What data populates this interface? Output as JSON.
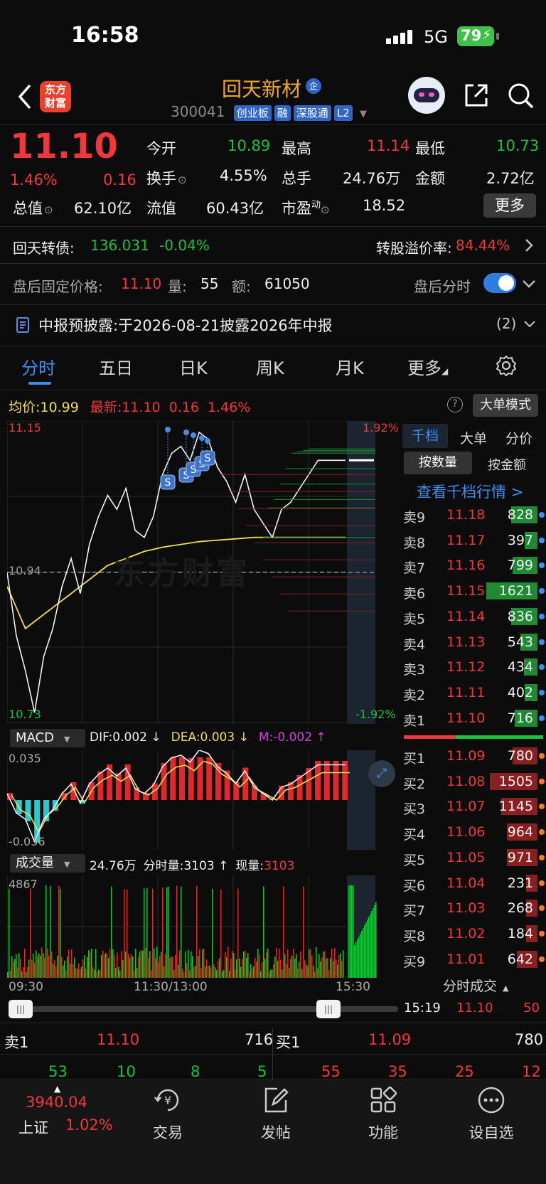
{
  "status": {
    "time": "16:58",
    "network": "5G",
    "battery": "79"
  },
  "header": {
    "logo_line1": "东方",
    "logo_line2": "财富",
    "stock_name": "回天新材",
    "name_badge": "企",
    "stock_code": "300041",
    "badges": [
      "创业板",
      "融",
      "深股通",
      "L2"
    ]
  },
  "quote": {
    "price": "11.10",
    "change_pct": "1.46%",
    "change": "0.16",
    "open_label": "今开",
    "open": "10.89",
    "high_label": "最高",
    "high": "11.14",
    "low_label": "最低",
    "low": "10.73",
    "turnover_label": "换手",
    "turnover": "4.55%",
    "volume_label": "总手",
    "volume": "24.76万",
    "amount_label": "金额",
    "amount": "2.72亿",
    "mcap_label": "总值",
    "mcap": "62.10亿",
    "float_label": "流值",
    "float": "60.43亿",
    "pe_label": "市盈",
    "pe_sup": "动",
    "pe": "18.52",
    "more_btn": "更多"
  },
  "bond": {
    "name": "回天转债:",
    "price": "136.031",
    "change": "-0.04%",
    "premium_label": "转股溢价率:",
    "premium": "84.44%"
  },
  "afterhours": {
    "label": "盘后固定价格:",
    "price": "11.10",
    "vol_label": "量:",
    "vol": "55",
    "amt_label": "额:",
    "amt": "61050",
    "toggle_label": "盘后分时"
  },
  "notice": {
    "text": "中报预披露:于2026-08-21披露2026年中报",
    "count": "(2)"
  },
  "tabs": [
    "分时",
    "五日",
    "日K",
    "周K",
    "月K",
    "更多"
  ],
  "chart_info": {
    "avg_label": "均价:",
    "avg": "10.99",
    "latest_label": "最新:",
    "latest": "11.10",
    "chg": "0.16",
    "pct": "1.46%",
    "big_order_btn": "大单模式"
  },
  "chart_data": {
    "type": "line",
    "y_top": "11.15",
    "y_mid": "10.94",
    "y_bottom": "10.73",
    "pct_top": "1.92%",
    "pct_bottom": "-1.92%",
    "x_labels": [
      "09:30",
      "11:30/13:00",
      "15:30"
    ],
    "ylim": [
      10.73,
      11.15
    ],
    "price": [
      10.94,
      10.85,
      10.8,
      10.74,
      10.82,
      10.86,
      10.92,
      10.96,
      10.91,
      10.98,
      11.02,
      11.05,
      11.03,
      11.06,
      11.0,
      10.99,
      11.02,
      11.08,
      11.11,
      11.12,
      11.1,
      11.14,
      11.13,
      11.09,
      11.07,
      11.04,
      11.08,
      11.03,
      11.01,
      10.99,
      11.03,
      11.04,
      11.06,
      11.08,
      11.1,
      11.1,
      11.1,
      11.1
    ],
    "avg": [
      10.92,
      10.89,
      10.86,
      10.87,
      10.88,
      10.89,
      10.9,
      10.91,
      10.92,
      10.93,
      10.94,
      10.95,
      10.955,
      10.96,
      10.965,
      10.97,
      10.973,
      10.976,
      10.978,
      10.98,
      10.982,
      10.984,
      10.985,
      10.986,
      10.987,
      10.988,
      10.989,
      10.99,
      10.99,
      10.99,
      10.99,
      10.99,
      10.99,
      10.99,
      10.99,
      10.99,
      10.99,
      10.99
    ],
    "macd_label": "MACD",
    "dif": "DIF:0.002 ↓",
    "dea": "DEA:0.003 ↓",
    "m": "M:-0.002 ↑",
    "macd_top": "0.035",
    "macd_bottom": "-0.036",
    "volume_label": "成交量",
    "vol_total": "24.76万",
    "vol_min_label": "分时量:",
    "vol_min": "3103 ↑",
    "vol_now_label": "现量:",
    "vol_now": "3103",
    "vol_top": "4867"
  },
  "orderbook": {
    "tabs": [
      "千档",
      "大单",
      "分价"
    ],
    "sort": [
      "按数量",
      "按金额"
    ],
    "link": "查看千档行情 >",
    "asks": [
      {
        "l": "卖9",
        "p": "11.18",
        "v": "828"
      },
      {
        "l": "卖8",
        "p": "11.17",
        "v": "397"
      },
      {
        "l": "卖7",
        "p": "11.16",
        "v": "799"
      },
      {
        "l": "卖6",
        "p": "11.15",
        "v": "1621"
      },
      {
        "l": "卖5",
        "p": "11.14",
        "v": "836"
      },
      {
        "l": "卖4",
        "p": "11.13",
        "v": "543"
      },
      {
        "l": "卖3",
        "p": "11.12",
        "v": "434"
      },
      {
        "l": "卖2",
        "p": "11.11",
        "v": "402"
      },
      {
        "l": "卖1",
        "p": "11.10",
        "v": "716"
      }
    ],
    "bids": [
      {
        "l": "买1",
        "p": "11.09",
        "v": "780"
      },
      {
        "l": "买2",
        "p": "11.08",
        "v": "1505"
      },
      {
        "l": "买3",
        "p": "11.07",
        "v": "1145"
      },
      {
        "l": "买4",
        "p": "11.06",
        "v": "964"
      },
      {
        "l": "买5",
        "p": "11.05",
        "v": "971"
      },
      {
        "l": "买6",
        "p": "11.04",
        "v": "231"
      },
      {
        "l": "买7",
        "p": "11.03",
        "v": "268"
      },
      {
        "l": "买8",
        "p": "11.02",
        "v": "184"
      },
      {
        "l": "买9",
        "p": "11.01",
        "v": "642"
      }
    ],
    "ticks_label": "分时成交",
    "tick_time": "15:19",
    "tick_price": "11.10",
    "tick_vol": "50"
  },
  "bottom_quote": {
    "ask_label": "卖1",
    "ask_price": "11.10",
    "ask_vol": "716",
    "bid_label": "买1",
    "bid_price": "11.09",
    "bid_vol": "780",
    "ask_q": [
      "53",
      "10",
      "8",
      "5"
    ],
    "bid_q": [
      "55",
      "35",
      "25",
      "12"
    ]
  },
  "index": {
    "value": "3940.04",
    "name": "上证",
    "pct": "1.02%"
  },
  "nav": [
    "交易",
    "发帖",
    "功能",
    "设自选"
  ],
  "colors": {
    "up": "#f0373b",
    "down": "#17c139",
    "accent": "#2f7de0",
    "avg": "#f2de4d"
  }
}
